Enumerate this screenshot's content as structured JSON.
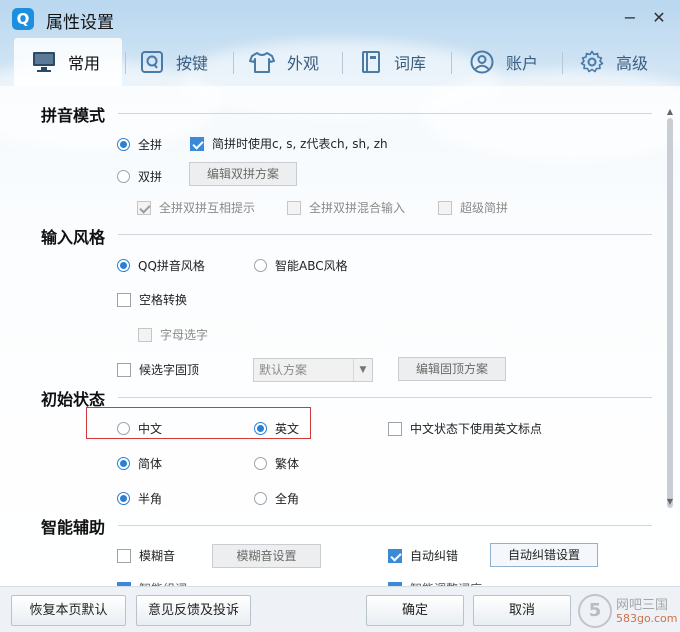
{
  "window": {
    "title": "属性设置",
    "logo_letter": "Q"
  },
  "controls": {
    "minimize": "−",
    "close": "✕"
  },
  "tabs": [
    {
      "label": "常用",
      "icon": "monitor-icon",
      "active": true
    },
    {
      "label": "按键",
      "icon": "key-q-icon",
      "active": false
    },
    {
      "label": "外观",
      "icon": "tshirt-icon",
      "active": false
    },
    {
      "label": "词库",
      "icon": "book-icon",
      "active": false
    },
    {
      "label": "账户",
      "icon": "user-icon",
      "active": false
    },
    {
      "label": "高级",
      "icon": "gear-icon",
      "active": false
    }
  ],
  "sections": {
    "pinyin_mode": {
      "title": "拼音模式",
      "full_pinyin": "全拼",
      "jianpin_option": "简拼时使用c, s, z代表ch, sh, zh",
      "double_pinyin": "双拼",
      "edit_double_pinyin": "编辑双拼方案",
      "mutual_hint": "全拼双拼互相提示",
      "mixed_input": "全拼双拼混合输入",
      "super_jianpin": "超级简拼"
    },
    "input_style": {
      "title": "输入风格",
      "qq_style": "QQ拼音风格",
      "abc_style": "智能ABC风格",
      "space_convert": "空格转换",
      "letter_select": "字母选字",
      "fixed_top": "候选字固顶",
      "default_scheme": "默认方案",
      "edit_fixed_scheme": "编辑固顶方案"
    },
    "initial_state": {
      "title": "初始状态",
      "chinese": "中文",
      "english": "英文",
      "english_punct": "中文状态下使用英文标点",
      "simplified": "简体",
      "traditional": "繁体",
      "half_width": "半角",
      "full_width": "全角"
    },
    "smart_assist": {
      "title": "智能辅助",
      "fuzzy": "模糊音",
      "fuzzy_settings": "模糊音设置",
      "autocorrect": "自动纠错",
      "autocorrect_settings": "自动纠错设置",
      "partial_left": "智能组词",
      "partial_right": "智能调整词序"
    }
  },
  "footer": {
    "restore_default": "恢复本页默认",
    "feedback": "意见反馈及投诉",
    "ok": "确定",
    "cancel": "取消"
  },
  "watermark": {
    "circle": "5",
    "line1": "网吧三国",
    "line2": "583go.com"
  }
}
